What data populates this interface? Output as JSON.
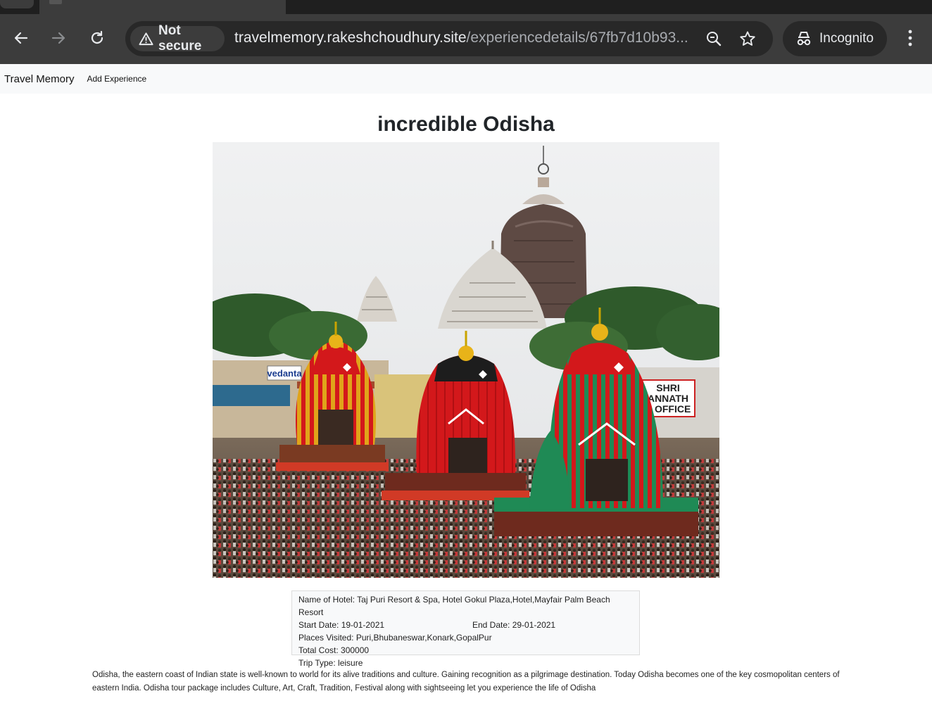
{
  "browser": {
    "security_label": "Not secure",
    "url_domain": "travelmemory.rakeshchoudhury.site",
    "url_path": "/experiencedetails/67fb7d10b93...",
    "profile_label": "Incognito"
  },
  "navbar": {
    "brand": "Travel Memory",
    "links": [
      "Add Experience"
    ]
  },
  "experience": {
    "title": "incredible Odisha",
    "hotel": "Name of Hotel: Taj Puri Resort & Spa, Hotel Gokul Plaza,Hotel,Mayfair Palm Beach Resort",
    "start_date": "Start Date: 19-01-2021",
    "end_date": "End Date: 29-01-2021",
    "places": "Places Visited: Puri,Bhubaneswar,Konark,GopalPur",
    "cost": "Total Cost: 300000",
    "trip_type": "Trip Type: leisure",
    "description": "Odisha, the eastern coast of Indian state is well-known to world for its alive traditions and culture. Gaining recognition as a pilgrimage destination. Today Odisha becomes one of the key cosmopolitan centers of eastern India. Odisha tour package includes Culture, Art, Craft, Tradition, Festival along with sightseeing let you experience the life of Odisha"
  },
  "photo_signs": {
    "left_sign": "vedanta",
    "right_sign_1": "SHRI",
    "right_sign_2": "ANNATH",
    "right_sign_3": "E OFFICE"
  },
  "icons": {
    "back": "arrow-left-icon",
    "forward": "arrow-right-icon",
    "reload": "reload-icon",
    "warning": "warning-triangle-icon",
    "zoom": "zoom-icon",
    "bookmark": "star-icon",
    "incognito": "incognito-icon",
    "menu": "kebab-menu-icon"
  },
  "colors": {
    "chrome_dark": "#3c3c3c",
    "omnibox": "#282828",
    "navbar_bg": "#f8f9fa",
    "chariot_red": "#d91a1a",
    "chariot_yellow": "#e8b319",
    "chariot_green": "#1f8a55"
  }
}
